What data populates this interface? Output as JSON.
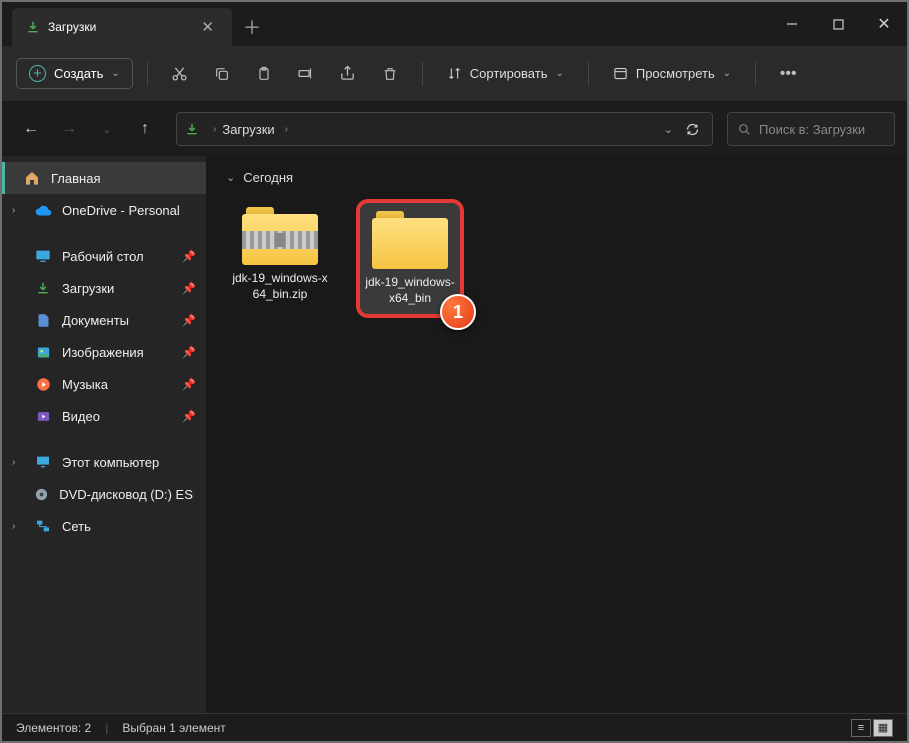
{
  "tab": {
    "title": "Загрузки"
  },
  "toolbar": {
    "create": "Создать",
    "sort": "Сортировать",
    "view": "Просмотреть"
  },
  "breadcrumb": {
    "item": "Загрузки"
  },
  "search": {
    "placeholder": "Поиск в: Загрузки"
  },
  "sidebar": {
    "home": "Главная",
    "onedrive": "OneDrive - Personal",
    "desktop": "Рабочий стол",
    "downloads": "Загрузки",
    "documents": "Документы",
    "pictures": "Изображения",
    "music": "Музыка",
    "videos": "Видео",
    "thispc": "Этот компьютер",
    "dvd": "DVD-дисковод (D:) ESD-IS",
    "network": "Сеть"
  },
  "group": {
    "today": "Сегодня"
  },
  "files": {
    "zip": "jdk-19_windows-x64_bin.zip",
    "folder": "jdk-19_windows-x64_bin"
  },
  "badge": {
    "num": "1"
  },
  "status": {
    "count": "Элементов: 2",
    "selected": "Выбран 1 элемент"
  }
}
